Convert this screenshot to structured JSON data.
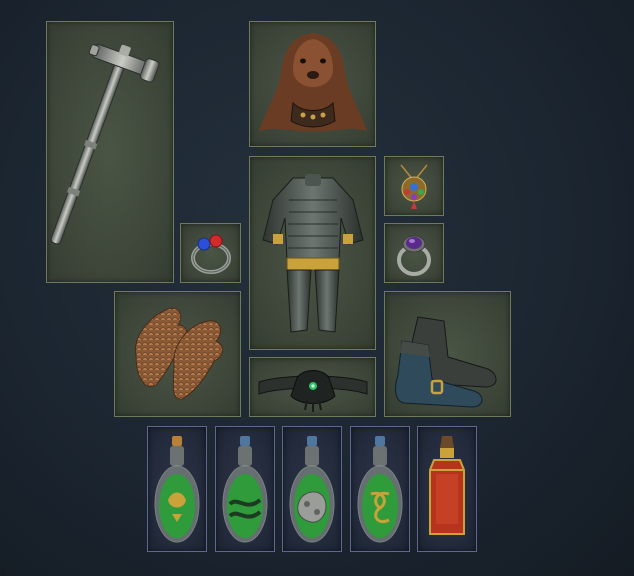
{
  "inventory": {
    "slots": [
      {
        "slot": "weapon",
        "icon": "war-hammer-icon"
      },
      {
        "slot": "helmet",
        "icon": "bear-pelt-helmet-icon"
      },
      {
        "slot": "body-armour",
        "icon": "plate-armour-icon"
      },
      {
        "slot": "amulet",
        "icon": "jeweled-amulet-icon"
      },
      {
        "slot": "ring-left",
        "icon": "gemmed-ring-icon"
      },
      {
        "slot": "ring-right",
        "icon": "amethyst-ring-icon"
      },
      {
        "slot": "gloves",
        "icon": "scale-gloves-icon"
      },
      {
        "slot": "belt",
        "icon": "dark-belt-icon"
      },
      {
        "slot": "boots",
        "icon": "leather-boots-icon"
      }
    ],
    "flasks": [
      {
        "slot": "flask-1",
        "icon": "green-flask-emblem-icon",
        "liquid": "#2f9b3a"
      },
      {
        "slot": "flask-2",
        "icon": "green-flask-wave-icon",
        "liquid": "#2f9b3a"
      },
      {
        "slot": "flask-3",
        "icon": "green-flask-stone-icon",
        "liquid": "#2f9b3a"
      },
      {
        "slot": "flask-4",
        "icon": "green-flask-knot-icon",
        "liquid": "#2f9b3a"
      },
      {
        "slot": "flask-5",
        "icon": "red-bottle-flask-icon",
        "liquid": "#b8331e"
      }
    ],
    "colors": {
      "slot_border": "#6f7a5c",
      "flask_border": "#5d6790",
      "background": "#1c2631"
    }
  }
}
